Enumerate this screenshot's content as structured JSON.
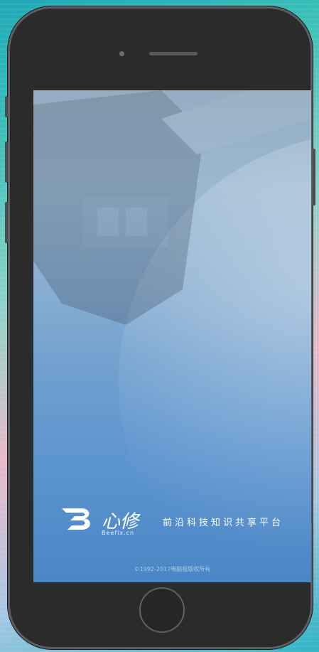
{
  "screen": {
    "brand_name": "心修",
    "brand_url": "Beefix.cn",
    "tagline": "前沿科技知识共享平台",
    "copyright": "©1992-2017电脑报版权所有"
  },
  "colors": {
    "bezel": "#2b2b2c",
    "screen_top": "#8fb0cc",
    "screen_bottom": "#4a86c7",
    "text": "#ffffff"
  },
  "icons": [
    "camera-icon",
    "speaker-icon",
    "home-button-icon",
    "brand-logo-icon"
  ]
}
